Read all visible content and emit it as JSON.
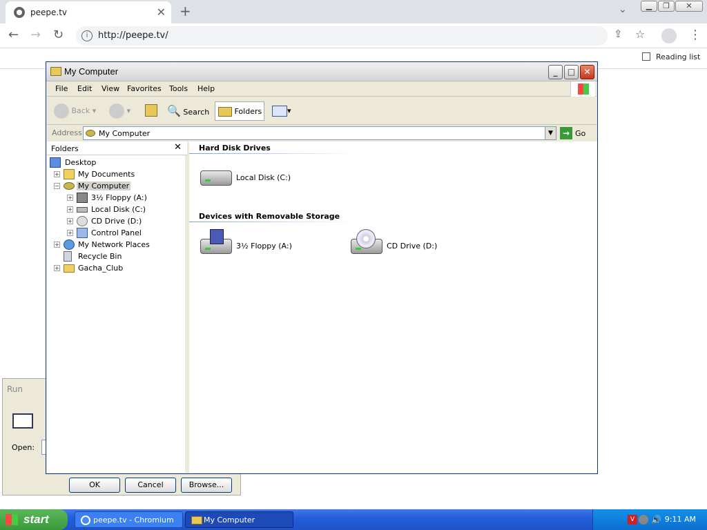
{
  "browser": {
    "tab_title": "peepe.tv",
    "url": "http://peepe.tv/",
    "reading_list": "Reading list"
  },
  "window": {
    "title": "My Computer",
    "menu": [
      "File",
      "Edit",
      "View",
      "Favorites",
      "Tools",
      "Help"
    ],
    "toolbar": {
      "back": "Back",
      "search": "Search",
      "folders": "Folders"
    },
    "address_label": "Address",
    "address_value": "My Computer",
    "go": "Go"
  },
  "folders_pane": {
    "title": "Folders",
    "tree": [
      {
        "label": "Desktop"
      },
      {
        "label": "My Documents"
      },
      {
        "label": "My Computer"
      },
      {
        "label": "3½ Floppy (A:)"
      },
      {
        "label": "Local Disk (C:)"
      },
      {
        "label": "CD Drive (D:)"
      },
      {
        "label": "Control Panel"
      },
      {
        "label": "My Network Places"
      },
      {
        "label": "Recycle Bin"
      },
      {
        "label": "Gacha_Club"
      }
    ]
  },
  "content": {
    "group1": "Hard Disk Drives",
    "local_disk": "Local Disk (C:)",
    "group2": "Devices with Removable Storage",
    "floppy": "3½ Floppy (A:)",
    "cd": "CD Drive (D:)"
  },
  "run_dialog": {
    "title": "Run",
    "open_label": "Open:",
    "ok": "OK",
    "cancel": "Cancel",
    "browse": "Browse..."
  },
  "taskbar": {
    "start": "start",
    "task1": "peepe.tv - Chromium",
    "task2": "My Computer",
    "clock": "9:11 AM"
  }
}
